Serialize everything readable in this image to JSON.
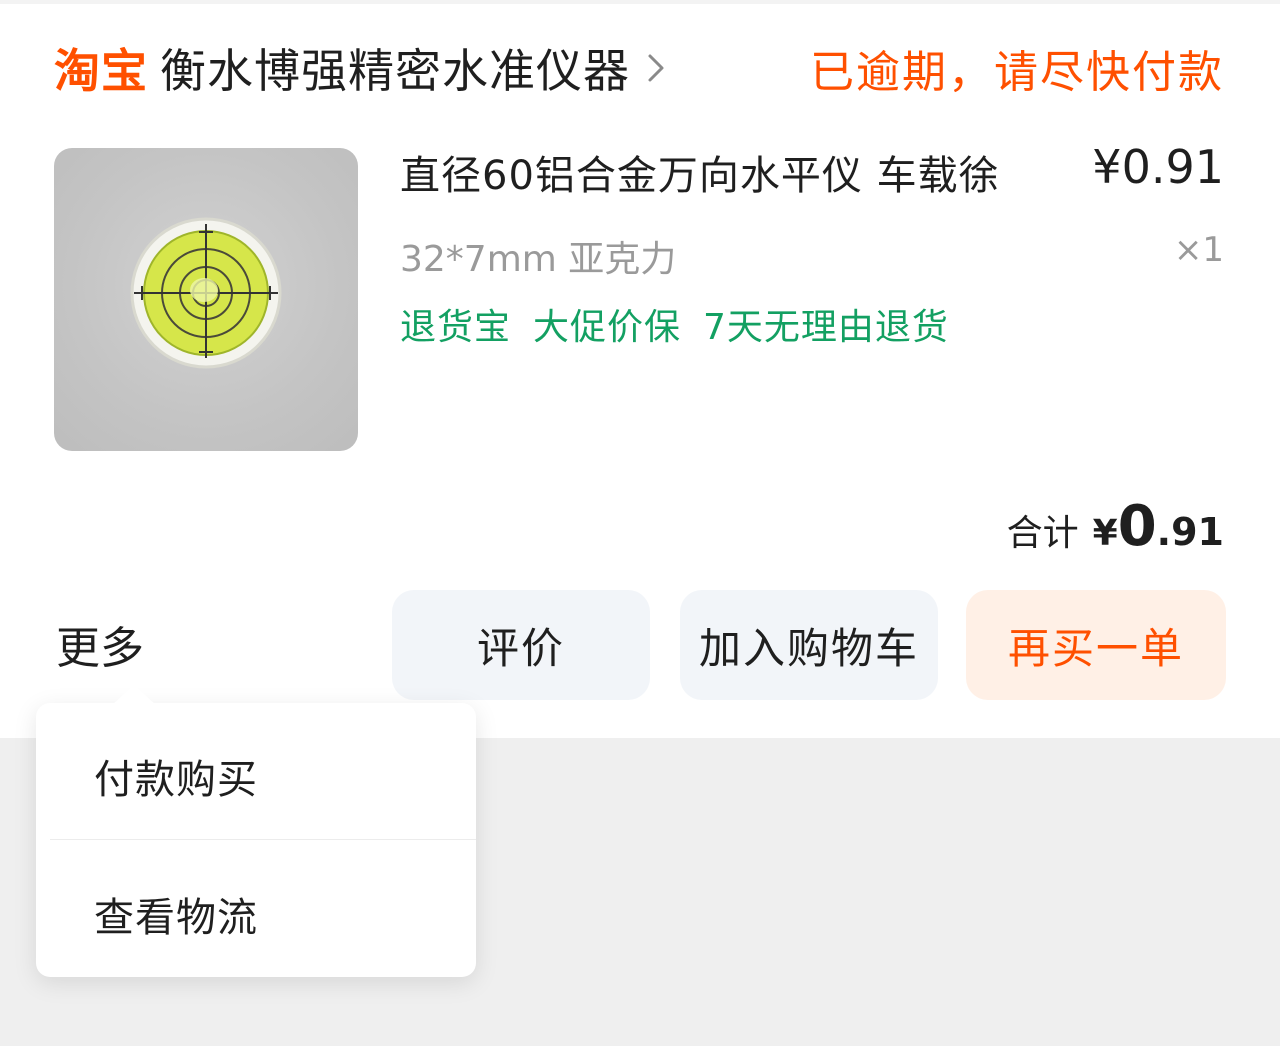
{
  "header": {
    "brand": "淘宝",
    "shop_name": "衡水博强精密水准仪器",
    "status": "已逾期，请尽快付款"
  },
  "product": {
    "title": "直径60铝合金万向水平仪 车载徐",
    "price": "¥0.91",
    "spec": "32*7mm 亚克力",
    "quantity": "×1",
    "tags": [
      "退货宝",
      "大促价保",
      "7天无理由退货"
    ]
  },
  "total": {
    "label": "合计",
    "currency": "¥",
    "amount_int": "0",
    "amount_dec": ".91"
  },
  "actions": {
    "more": "更多",
    "review": "评价",
    "add_to_cart": "加入购物车",
    "buy_again": "再买一单"
  },
  "more_menu": {
    "items": [
      "付款购买",
      "查看物流"
    ]
  },
  "colors": {
    "brand": "#ff5000",
    "tag_green": "#13a062",
    "secondary_text": "#9a9a9a"
  }
}
